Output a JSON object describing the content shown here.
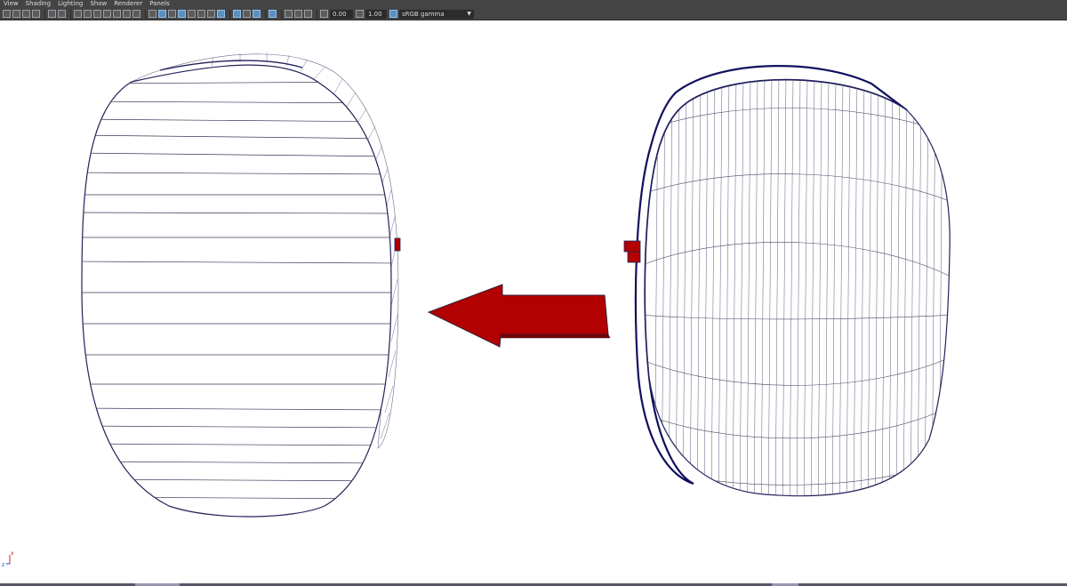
{
  "menu": [
    "View",
    "Shading",
    "Lighting",
    "Show",
    "Renderer",
    "Panels"
  ],
  "toolbar": {
    "field_a": "0.00",
    "field_b": "1.00",
    "color_space": "sRGB gamma"
  },
  "viewport": {
    "axis_labels": {
      "x": "x",
      "z": "z"
    },
    "colors": {
      "background": "#ffffff",
      "wire": "#1a1a55",
      "arrow": "#b30000"
    }
  }
}
